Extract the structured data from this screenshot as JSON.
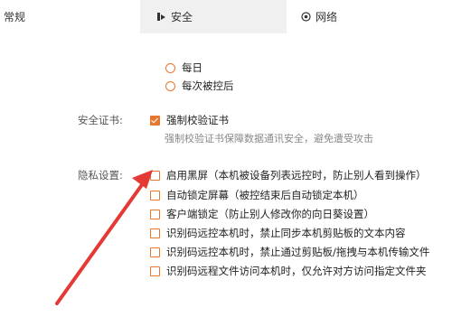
{
  "tabs": {
    "general": "常规",
    "security": "安全",
    "network": "网络"
  },
  "reconnect_options": [
    {
      "label": "每日",
      "checked": false
    },
    {
      "label": "每次被控后",
      "checked": false
    }
  ],
  "certificate": {
    "section_label": "安全证书:",
    "force_verify_label": "强制校验证书",
    "force_verify_checked": true,
    "hint": "强制校验证书保障数据通讯安全，避免遭受攻击"
  },
  "privacy": {
    "section_label": "隐私设置:",
    "items": [
      {
        "label": "启用黑屏（本机被设备列表远控时，防止别人看到操作）",
        "checked": false
      },
      {
        "label": "自动锁定屏幕（被控结束后自动锁定本机）",
        "checked": false
      },
      {
        "label": "客户端锁定（防止别人修改你的向日葵设置）",
        "checked": false
      },
      {
        "label": "识别码远控本机时，禁止同步本机剪贴板的文本内容",
        "checked": false
      },
      {
        "label": "识别码远控本机时，禁止通过剪贴板/拖拽与本机传输文件",
        "checked": false
      },
      {
        "label": "识别码远程文件访问本机时，仅允许对方访问指定文件夹",
        "checked": false
      }
    ]
  },
  "colors": {
    "accent": "#e8772e",
    "annotation_arrow": "#e53935",
    "active_tab_bg": "#f0f0f0"
  },
  "icons": {
    "security_tab": "shield-lock-icon",
    "network_tab": "globe-icon"
  }
}
